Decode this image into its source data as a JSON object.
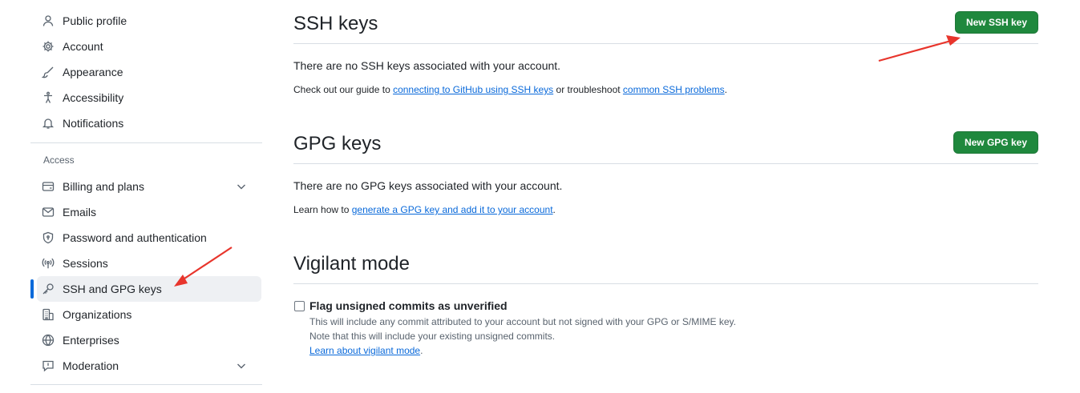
{
  "sidebar": {
    "items_top": [
      {
        "label": "Public profile",
        "icon": "person-icon"
      },
      {
        "label": "Account",
        "icon": "gear-icon"
      },
      {
        "label": "Appearance",
        "icon": "paintbrush-icon"
      },
      {
        "label": "Accessibility",
        "icon": "accessibility-icon"
      },
      {
        "label": "Notifications",
        "icon": "bell-icon"
      }
    ],
    "access_label": "Access",
    "items_access": [
      {
        "label": "Billing and plans",
        "icon": "credit-card-icon"
      },
      {
        "label": "Emails",
        "icon": "mail-icon"
      },
      {
        "label": "Password and authentication",
        "icon": "shield-lock-icon"
      },
      {
        "label": "Sessions",
        "icon": "broadcast-icon"
      },
      {
        "label": "SSH and GPG keys",
        "icon": "key-icon"
      },
      {
        "label": "Organizations",
        "icon": "organization-icon"
      },
      {
        "label": "Enterprises",
        "icon": "globe-icon"
      },
      {
        "label": "Moderation",
        "icon": "report-icon"
      }
    ]
  },
  "ssh": {
    "title": "SSH keys",
    "button": "New SSH key",
    "empty": "There are no SSH keys associated with your account.",
    "guide_prefix": "Check out our guide to ",
    "guide_link1": "connecting to GitHub using SSH keys",
    "guide_middle": " or troubleshoot ",
    "guide_link2": "common SSH problems",
    "guide_suffix": "."
  },
  "gpg": {
    "title": "GPG keys",
    "button": "New GPG key",
    "empty": "There are no GPG keys associated with your account.",
    "learn_prefix": "Learn how to ",
    "learn_link": "generate a GPG key and add it to your account",
    "learn_suffix": "."
  },
  "vigilant": {
    "title": "Vigilant mode",
    "checkbox_label": "Flag unsigned commits as unverified",
    "desc1": "This will include any commit attributed to your account but not signed with your GPG or S/MIME key.",
    "desc2": "Note that this will include your existing unsigned commits.",
    "learn_link": "Learn about vigilant mode",
    "learn_suffix": "."
  },
  "colors": {
    "primary_button": "#1f883d",
    "link": "#0969da",
    "active_indicator": "#0969da",
    "annotation_arrow": "#e8352c"
  }
}
